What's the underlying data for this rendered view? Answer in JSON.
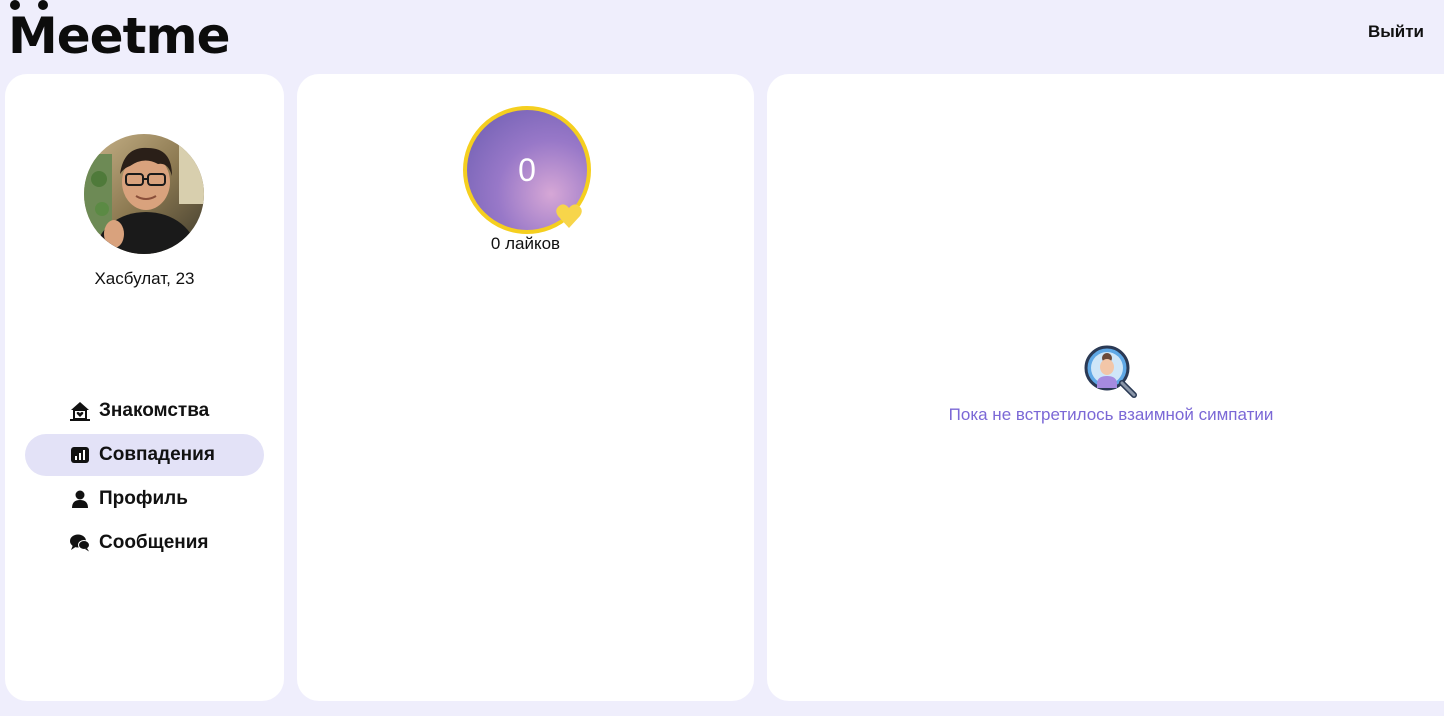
{
  "app": {
    "logo_text": "eetme",
    "logo_initial": "M",
    "logout_label": "Выйти"
  },
  "profile": {
    "name_age": "Хасбулат, 23",
    "avatar_icon": "user-photo"
  },
  "nav": {
    "items": [
      {
        "label": "Знакомства",
        "icon": "home-heart-icon",
        "active": false
      },
      {
        "label": "Совпадения",
        "icon": "chart-icon",
        "active": true
      },
      {
        "label": "Профиль",
        "icon": "person-icon",
        "active": false
      },
      {
        "label": "Сообщения",
        "icon": "chat-icon",
        "active": false
      }
    ]
  },
  "likes": {
    "count": "0",
    "label": "0 лайков"
  },
  "matches": {
    "empty_text": "Пока не встретилось взаимной симпатии"
  },
  "colors": {
    "background": "#efeefc",
    "active_nav": "#e3e2f7",
    "accent_text": "#7b68d6",
    "ring": "#f5cf1f"
  }
}
